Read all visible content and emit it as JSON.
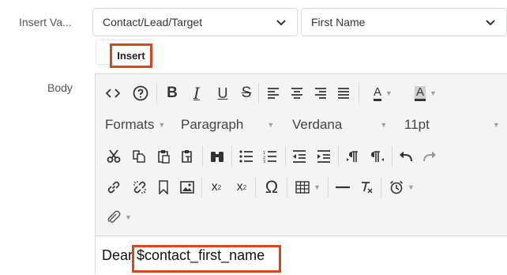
{
  "form": {
    "insert_variable_label": "Insert Va...",
    "module_select": "Contact/Lead/Target",
    "field_select": "First Name",
    "insert_button": "Insert",
    "body_label": "Body"
  },
  "toolbar": {
    "formats": "Formats",
    "block": "Paragraph",
    "font_family": "Verdana",
    "font_size": "11pt",
    "bold": "B",
    "italic": "I",
    "underline": "U",
    "strike": "S",
    "text_color": "A",
    "bg_color": "A",
    "omega": "Ω",
    "superscript_base": "x",
    "subscript_base": "x",
    "sup_mark": "2",
    "sub_mark": "2"
  },
  "editor": {
    "body_prefix": "Dear ",
    "variable": "$contact_first_name"
  },
  "colors": {
    "highlight": "#d9481c",
    "toolbar_bg": "#f4f4f4",
    "border": "#d8d8d8"
  }
}
